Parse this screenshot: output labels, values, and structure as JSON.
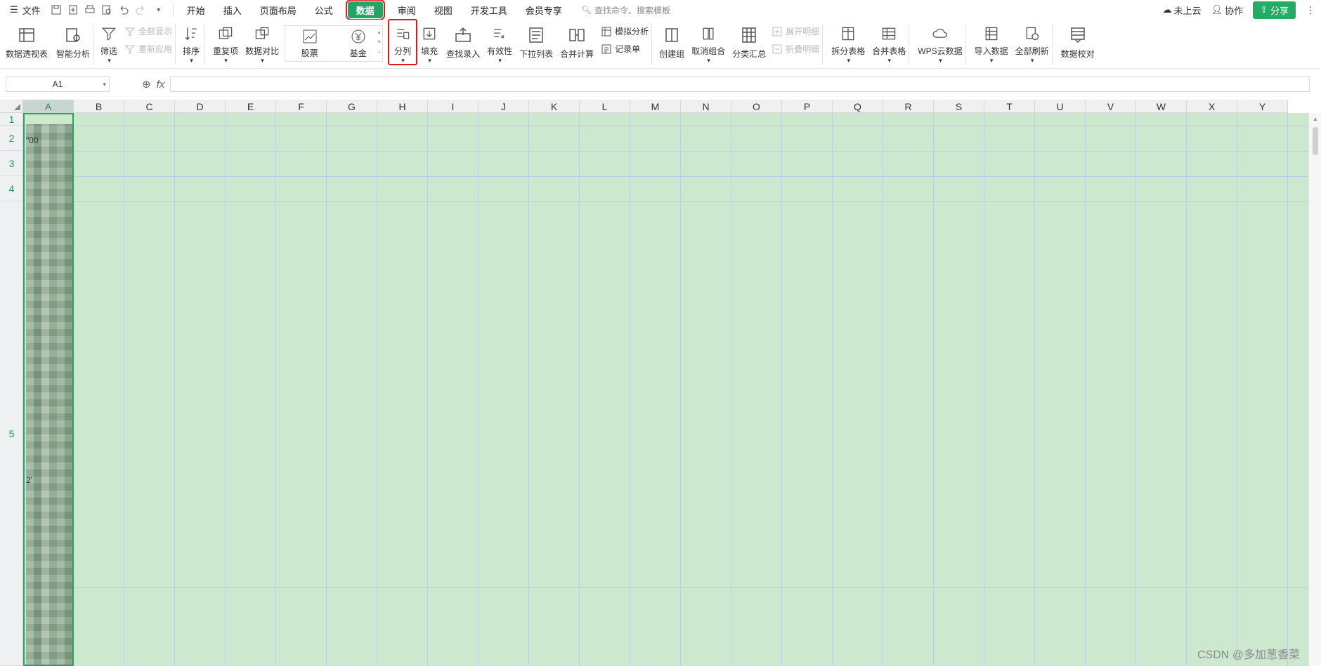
{
  "menubar": {
    "file_label": "文件",
    "tabs": [
      {
        "label": "开始"
      },
      {
        "label": "插入"
      },
      {
        "label": "页面布局"
      },
      {
        "label": "公式"
      },
      {
        "label": "数据"
      },
      {
        "label": "审阅"
      },
      {
        "label": "视图"
      },
      {
        "label": "开发工具"
      },
      {
        "label": "会员专享"
      }
    ],
    "active_tab": "数据",
    "search_placeholder": "查找命令、搜索模板",
    "cloud_label": "未上云",
    "collab_label": "协作",
    "share_label": "分享"
  },
  "ribbon": {
    "pivot": "数据透视表",
    "smart": "智能分析",
    "filter": "筛选",
    "show_all": "全部显示",
    "reapply": "重新应用",
    "sort": "排序",
    "duplicates": "重复项",
    "compare": "数据对比",
    "stock": "股票",
    "fund": "基金",
    "split_column": "分列",
    "fill": "填充",
    "lookup": "查找录入",
    "validity": "有效性",
    "dropdown": "下拉列表",
    "consolidate": "合并计算",
    "simulate": "模拟分析",
    "record": "记录单",
    "group": "创建组",
    "ungroup": "取消组合",
    "subtotal": "分类汇总",
    "expand_detail": "展开明细",
    "collapse_detail": "折叠明细",
    "split_table": "拆分表格",
    "merge_table": "合并表格",
    "wps_cloud": "WPS云数据",
    "import": "导入数据",
    "refresh_all": "全部刷新",
    "proofread": "数据校对"
  },
  "formula": {
    "name_box": "A1",
    "fx": "fx",
    "value": ""
  },
  "sheet": {
    "columns": [
      "A",
      "B",
      "C",
      "D",
      "E",
      "F",
      "G",
      "H",
      "I",
      "J",
      "K",
      "L",
      "M",
      "N",
      "O",
      "P",
      "Q",
      "R",
      "S",
      "T",
      "U",
      "V",
      "W",
      "X",
      "Y"
    ],
    "rows": [
      "1",
      "2",
      "3",
      "4",
      "5"
    ],
    "cell_a2": "\"00",
    "cell_a5": "2'",
    "colors": {
      "selection_fill": "#cce8cf",
      "accent": "#22a85e",
      "highlight": "#e0191f"
    }
  },
  "watermark": "CSDN @多加葱香菜"
}
